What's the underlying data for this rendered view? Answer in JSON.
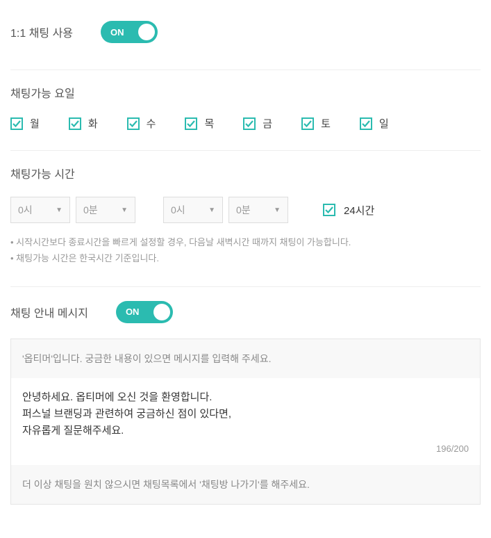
{
  "chatToggle": {
    "title": "1:1 채팅 사용",
    "state": "ON"
  },
  "days": {
    "title": "채팅가능 요일",
    "items": [
      {
        "label": "월",
        "checked": true
      },
      {
        "label": "화",
        "checked": true
      },
      {
        "label": "수",
        "checked": true
      },
      {
        "label": "목",
        "checked": true
      },
      {
        "label": "금",
        "checked": true
      },
      {
        "label": "토",
        "checked": true
      },
      {
        "label": "일",
        "checked": true
      }
    ]
  },
  "time": {
    "title": "채팅가능 시간",
    "startHour": "0시",
    "startMin": "0분",
    "endHour": "0시",
    "endMin": "0분",
    "allDayLabel": "24시간",
    "allDayChecked": true,
    "note1": "시작시간보다 종료시간을 빠르게 설정할 경우, 다음날 새벽시간 때까지 채팅이 가능합니다.",
    "note2": "채팅가능 시간은 한국시간 기준입니다."
  },
  "message": {
    "title": "채팅 안내 메시지",
    "state": "ON",
    "greeting": "'옵티머'입니다. 궁금한 내용이 있으면 메시지를 입력해 주세요.",
    "body": "안녕하세요. 옵티머에 오신 것을 환영합니다.\n퍼스널 브랜딩과 관련하여 궁금하신 점이 있다면,\n자유롭게 질문해주세요.",
    "counter": "196/200",
    "footer": "더 이상 채팅을 원치 않으시면 채팅목록에서 '채팅방 나가기'를 해주세요."
  }
}
